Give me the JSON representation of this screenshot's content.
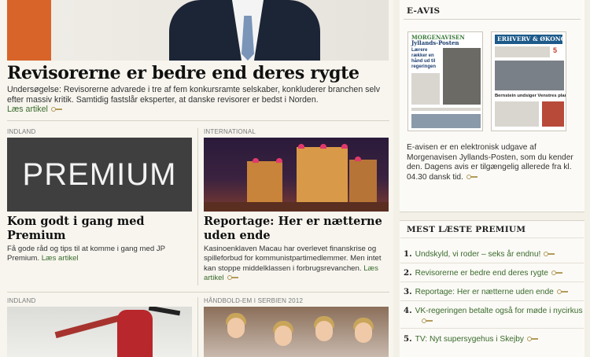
{
  "hero": {
    "headline": "Revisorerne er bedre end deres rygte",
    "lead": "Undersøgelse: Revisorerne advarede i tre af fem konkursramte selskaber, konkluderer branchen selv efter massiv kritik. Samtidig fastslår eksperter, at danske revisorer er bedst i Norden.",
    "link": "Læs artikel"
  },
  "articles": [
    {
      "section": "INDLAND",
      "image_text": "PREMIUM",
      "title": "Kom godt i gang med Premium",
      "body": "Få gode råd og tips til at komme i gang med JP Premium.",
      "link": "Læs artikel"
    },
    {
      "section": "INTERNATIONAL",
      "title": "Reportage: Her er nætterne uden ende",
      "body": "Kasinoenklaven Macau har overlevet finanskrise og spilleforbud for kommunistpartimedlemmer. Men intet kan stoppe middelklassen i forbrugsrevanchen.",
      "link": "Læs artikel"
    },
    {
      "section": "INDLAND"
    },
    {
      "section": "HÅNDBOLD-EM I SERBIEN 2012"
    }
  ],
  "eavis": {
    "heading": "E-AVIS",
    "paper1": {
      "masthead1": "MORGENAVISEN",
      "masthead2": "Jyllands-Posten",
      "headline": "Lærere rækker en hånd ud til regeringen"
    },
    "paper2": {
      "masthead": "ERHVERV & ØKONOMI",
      "number": "5",
      "headline": "Bernstein undsiger Venstres plan"
    },
    "text": "E-avisen er en elektronisk udgave af Morgenavisen Jyllands-Posten, som du kender den. Dagens avis er tilgængelig allerede fra kl. 04.30 dansk tid."
  },
  "most_read": {
    "heading": "MEST LÆSTE PREMIUM",
    "items": [
      {
        "num": "1.",
        "label": "Undskyld, vi roder – seks år endnu!"
      },
      {
        "num": "2.",
        "label": "Revisorerne er bedre end deres rygte"
      },
      {
        "num": "3.",
        "label": "Reportage: Her er nætterne uden ende"
      },
      {
        "num": "4.",
        "label": "VK-regeringen betalte også for møde i nycirkus"
      },
      {
        "num": "5.",
        "label": "TV: Nyt supersygehus i Skejby"
      }
    ]
  },
  "colors": {
    "link_green": "#3a6b2c",
    "key_gold": "#b39b5a",
    "premium_bg": "#3f3f3f"
  }
}
